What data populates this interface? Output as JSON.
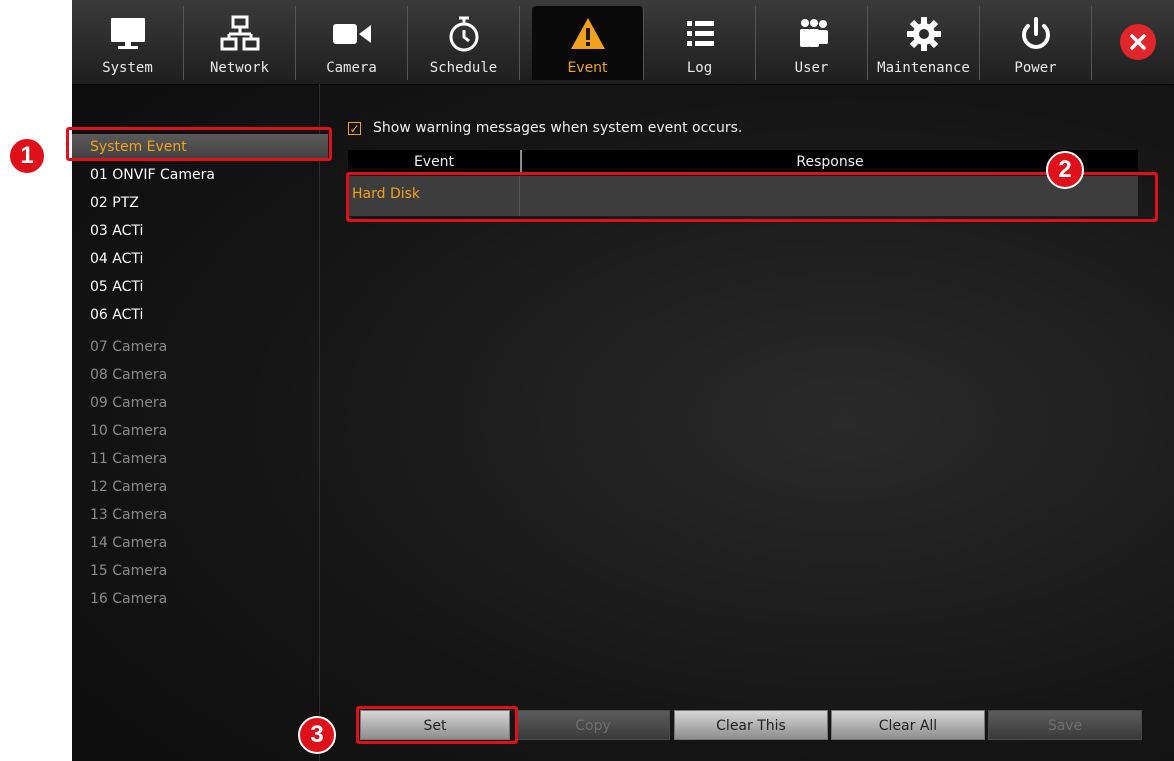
{
  "toolbar": {
    "tabs": [
      {
        "label": "System",
        "icon": "monitor-icon"
      },
      {
        "label": "Network",
        "icon": "network-icon"
      },
      {
        "label": "Camera",
        "icon": "camera-icon"
      },
      {
        "label": "Schedule",
        "icon": "timer-icon"
      },
      {
        "label": "Event",
        "icon": "warning-icon"
      },
      {
        "label": "Log",
        "icon": "list-icon"
      },
      {
        "label": "User",
        "icon": "users-icon"
      },
      {
        "label": "Maintenance",
        "icon": "gear-icon"
      },
      {
        "label": "Power",
        "icon": "power-icon"
      }
    ],
    "active_tab": "Event"
  },
  "sidebar": {
    "items": [
      {
        "label": "System Event",
        "state": "selected"
      },
      {
        "label": "01 ONVIF Camera",
        "state": "active"
      },
      {
        "label": "02 PTZ",
        "state": "active"
      },
      {
        "label": "03 ACTi",
        "state": "active"
      },
      {
        "label": "04 ACTi",
        "state": "active"
      },
      {
        "label": "05 ACTi",
        "state": "active"
      },
      {
        "label": "06 ACTi",
        "state": "active"
      },
      {
        "label": "07 Camera",
        "state": "dim"
      },
      {
        "label": "08 Camera",
        "state": "dim"
      },
      {
        "label": "09 Camera",
        "state": "dim"
      },
      {
        "label": "10 Camera",
        "state": "dim"
      },
      {
        "label": "11 Camera",
        "state": "dim"
      },
      {
        "label": "12 Camera",
        "state": "dim"
      },
      {
        "label": "13 Camera",
        "state": "dim"
      },
      {
        "label": "14 Camera",
        "state": "dim"
      },
      {
        "label": "15 Camera",
        "state": "dim"
      },
      {
        "label": "16 Camera",
        "state": "dim"
      }
    ]
  },
  "main": {
    "warning_checkbox_label": "Show warning messages when system event occurs.",
    "warning_checked": true,
    "table": {
      "columns": [
        "Event",
        "Response"
      ],
      "rows": [
        {
          "event": "Hard Disk",
          "response": ""
        }
      ]
    }
  },
  "buttons": {
    "set": "Set",
    "copy": "Copy",
    "clear_this": "Clear This",
    "clear_all": "Clear All",
    "save": "Save"
  },
  "annotations": {
    "badge1": "1",
    "badge2": "2",
    "badge3": "3"
  },
  "colors": {
    "accent": "#f0a21e",
    "annotation_red": "#e0101a"
  }
}
